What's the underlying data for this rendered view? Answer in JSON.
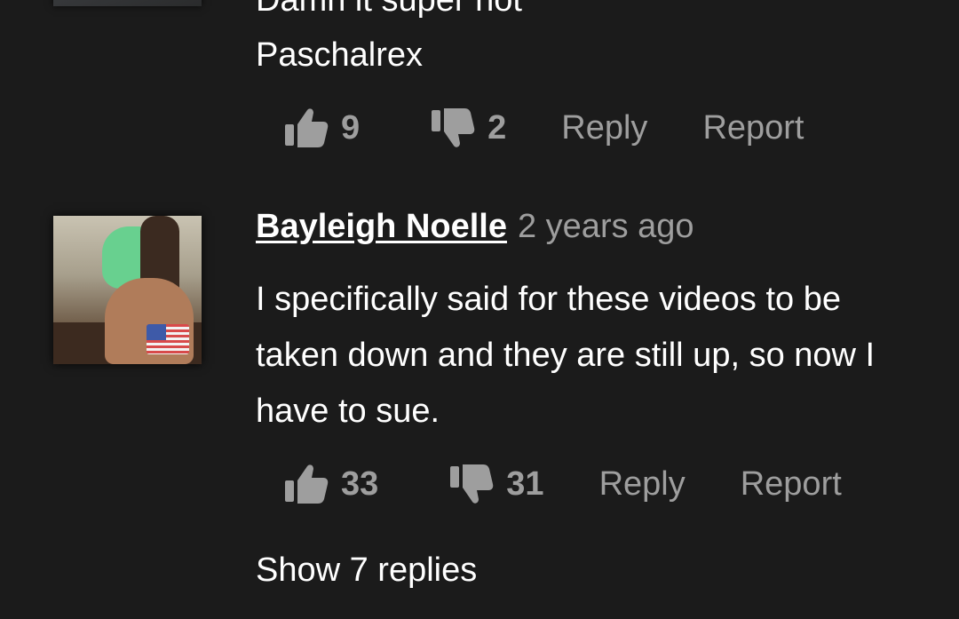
{
  "previous_comment": {
    "text_partial": "Damn it super hot",
    "signature": "Paschalrex",
    "likes": "9",
    "dislikes": "2",
    "reply_label": "Reply",
    "report_label": "Report"
  },
  "comment": {
    "author": "Bayleigh Noelle",
    "timestamp": "2 years ago",
    "text": "I specifically said for these videos to be taken down and they are still up, so now I have to sue.",
    "likes": "33",
    "dislikes": "31",
    "reply_label": "Reply",
    "report_label": "Report",
    "show_replies_label": "Show 7 replies",
    "flag_icon": "us-flag-icon"
  },
  "colors": {
    "background": "#1b1b1b",
    "text": "#ffffff",
    "muted": "#9e9e9e"
  }
}
